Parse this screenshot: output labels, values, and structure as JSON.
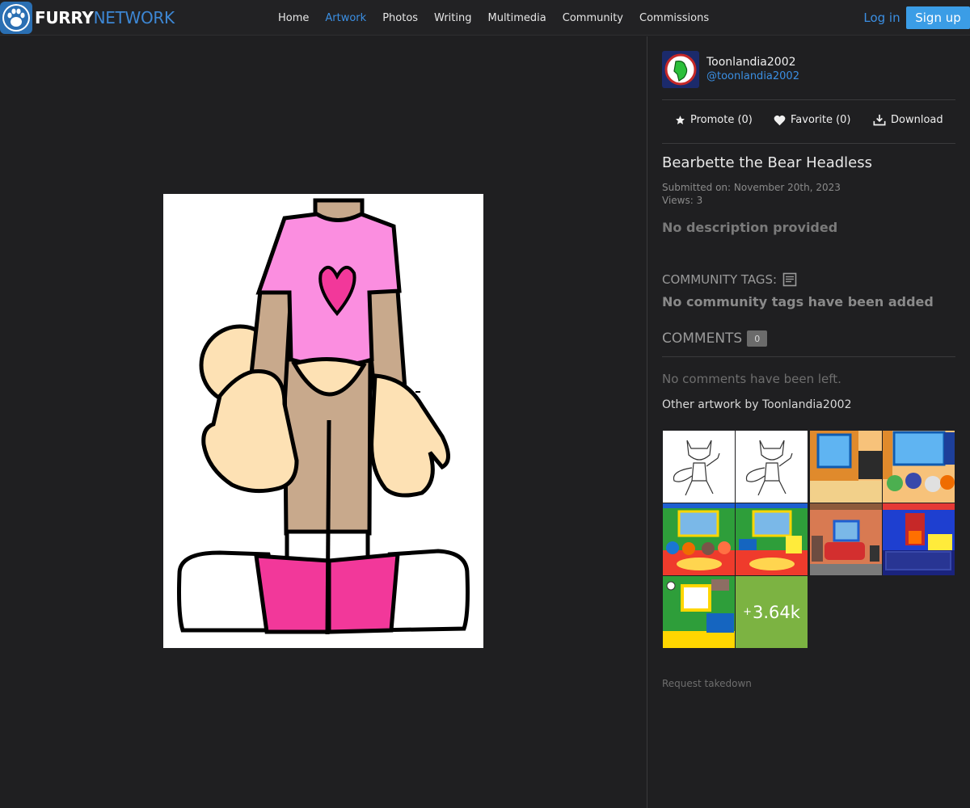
{
  "logo": {
    "part_a": "FURRY",
    "part_b": "NETWORK"
  },
  "nav": {
    "items": [
      {
        "label": "Home",
        "active": false
      },
      {
        "label": "Artwork",
        "active": true
      },
      {
        "label": "Photos",
        "active": false
      },
      {
        "label": "Writing",
        "active": false
      },
      {
        "label": "Multimedia",
        "active": false
      },
      {
        "label": "Community",
        "active": false
      },
      {
        "label": "Commissions",
        "active": false
      }
    ],
    "login_label": "Log in",
    "signup_label": "Sign up"
  },
  "artist": {
    "display_name": "Toonlandia2002",
    "handle": "@toonlandia2002"
  },
  "actions": {
    "promote": "Promote (0)",
    "favorite": "Favorite (0)",
    "download": "Download"
  },
  "artwork": {
    "title": "Bearbette the Bear Headless",
    "submitted": "Submitted on: November 20th, 2023",
    "views": "Views: 3",
    "description": "No description provided"
  },
  "tags": {
    "heading": "COMMUNITY TAGS:",
    "empty": "No community tags have been added"
  },
  "comments": {
    "heading": "COMMENTS",
    "count": "0",
    "empty": "No comments have been left."
  },
  "other": {
    "heading": "Other artwork by Toonlandia2002",
    "more_prefix": "+",
    "more_count": "3.64k"
  },
  "footer": {
    "takedown": "Request takedown"
  },
  "colors": {
    "accent": "#3b8fe3",
    "signup_bg": "#3b9de6",
    "more_tile": "#7cb342",
    "background": "#1f1f21"
  }
}
